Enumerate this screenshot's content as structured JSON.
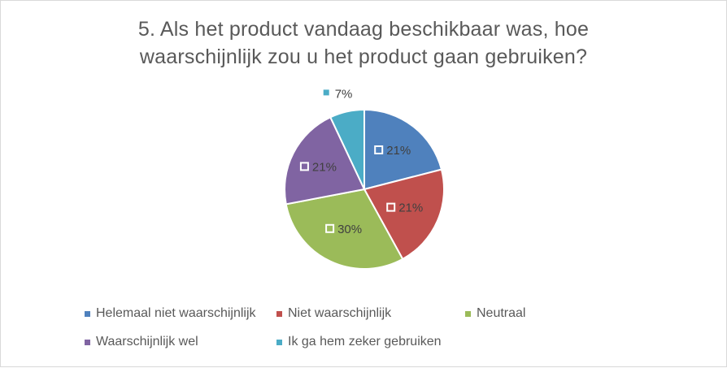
{
  "chart_data": {
    "type": "pie",
    "title_lines": [
      "5. Als het product vandaag beschikbaar was, hoe",
      "waarschijnlijk zou u het product gaan gebruiken?"
    ],
    "categories": [
      "Helemaal niet waarschijnlijk",
      "Niet waarschijnlijk",
      "Neutraal",
      "Waarschijnlijk wel",
      "Ik ga hem zeker gebruiken"
    ],
    "values": [
      21,
      21,
      30,
      21,
      7
    ],
    "data_labels": [
      "21%",
      "21%",
      "30%",
      "21%",
      "7%"
    ],
    "colors": [
      "#4f81bd",
      "#c0504d",
      "#9bbb59",
      "#8064a2",
      "#4bacc6"
    ],
    "legend_position": "bottom"
  }
}
